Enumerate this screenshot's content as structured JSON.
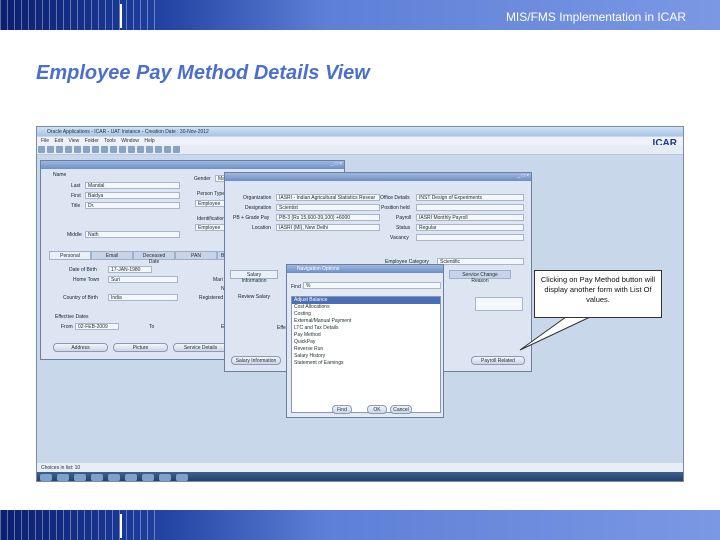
{
  "header": {
    "text": "MIS/FMS Implementation in ICAR"
  },
  "page": {
    "title": "Employee Pay Method Details View"
  },
  "app": {
    "title_bar": "Oracle Applications - ICAR - UAT Instance - Creation Date : 30-Nov-2012",
    "menu": [
      "File",
      "Edit",
      "View",
      "Folder",
      "Tools",
      "Window",
      "Help"
    ],
    "logo": "ICAR",
    "status": "Choices in list: 10"
  },
  "people": {
    "name_label": "Name",
    "last_label": "Last",
    "last": "Mandal",
    "first_label": "First",
    "first": "Baidya",
    "title_label": "Title",
    "title": "Dr.",
    "middle_label": "Middle",
    "middle": "Nath",
    "gender_label": "Gender",
    "gender": "Ma",
    "person_type_label": "Person Type",
    "person_type": "Employee",
    "identification_label": "Identification",
    "identification": "Employee",
    "tabs": [
      "Personal",
      "Email",
      "Deceased Date",
      "PAN",
      "Be"
    ],
    "dob_label": "Date of Birth",
    "dob": "17-JAN-1980",
    "hometown_label": "Home Town",
    "hometown": "Suri",
    "country_label": "Country of Birth",
    "country": "India",
    "mar_label": "Mari",
    "n_label": "N",
    "registered_label": "Registered",
    "effective_label": "Effective Dates",
    "from_label": "From",
    "from": "02-FEB-2009",
    "to_label": "To",
    "e_label": "E",
    "buttons": [
      "Address",
      "Picture",
      "Service Details"
    ]
  },
  "service": {
    "org_label": "Organization",
    "org": "IASRI - Indian Agricultural Statistics Resear",
    "designation_label": "Designation",
    "designation": "Scientist",
    "pb_label": "PB + Grade Pay",
    "pb": "PB-3 (Rs 15,600-39,100) +6000",
    "location_label": "Location",
    "location": "IASRI (MI), New Delhi",
    "office_label": "Office Details",
    "office": "INST Design of Experiments",
    "position_label": "Position held",
    "payroll_label": "Payroll",
    "payroll": "IASRI Monthly Payroll",
    "status_label": "Status",
    "status": "Regular",
    "vacancy_label": "Vacancy",
    "emp_cat_label": "Employee Category",
    "emp_cat": "Scientific",
    "tab_salary": "Salary Information",
    "tab_service_change": "Service Change Reason",
    "review_label": "Review Salary",
    "effe_label": "Effe",
    "btn_salary": "Salary Information",
    "btn_payroll": "Payroll Related"
  },
  "nav": {
    "title": "Navigation Options",
    "find_label": "Find",
    "find_value": "%",
    "items": [
      "Adjust Balance",
      "Cost Allocations",
      "Costing",
      "External/Manual Payment",
      "LTC and Tax Details",
      "Pay Method",
      "QuickPay",
      "Reverse Run",
      "Salary History",
      "Statement of Earnings"
    ],
    "btn_find": "Find",
    "btn_ok": "OK",
    "btn_cancel": "Cancel"
  },
  "callout": {
    "text": "Clicking on Pay Method button will display another form with List Of values."
  }
}
